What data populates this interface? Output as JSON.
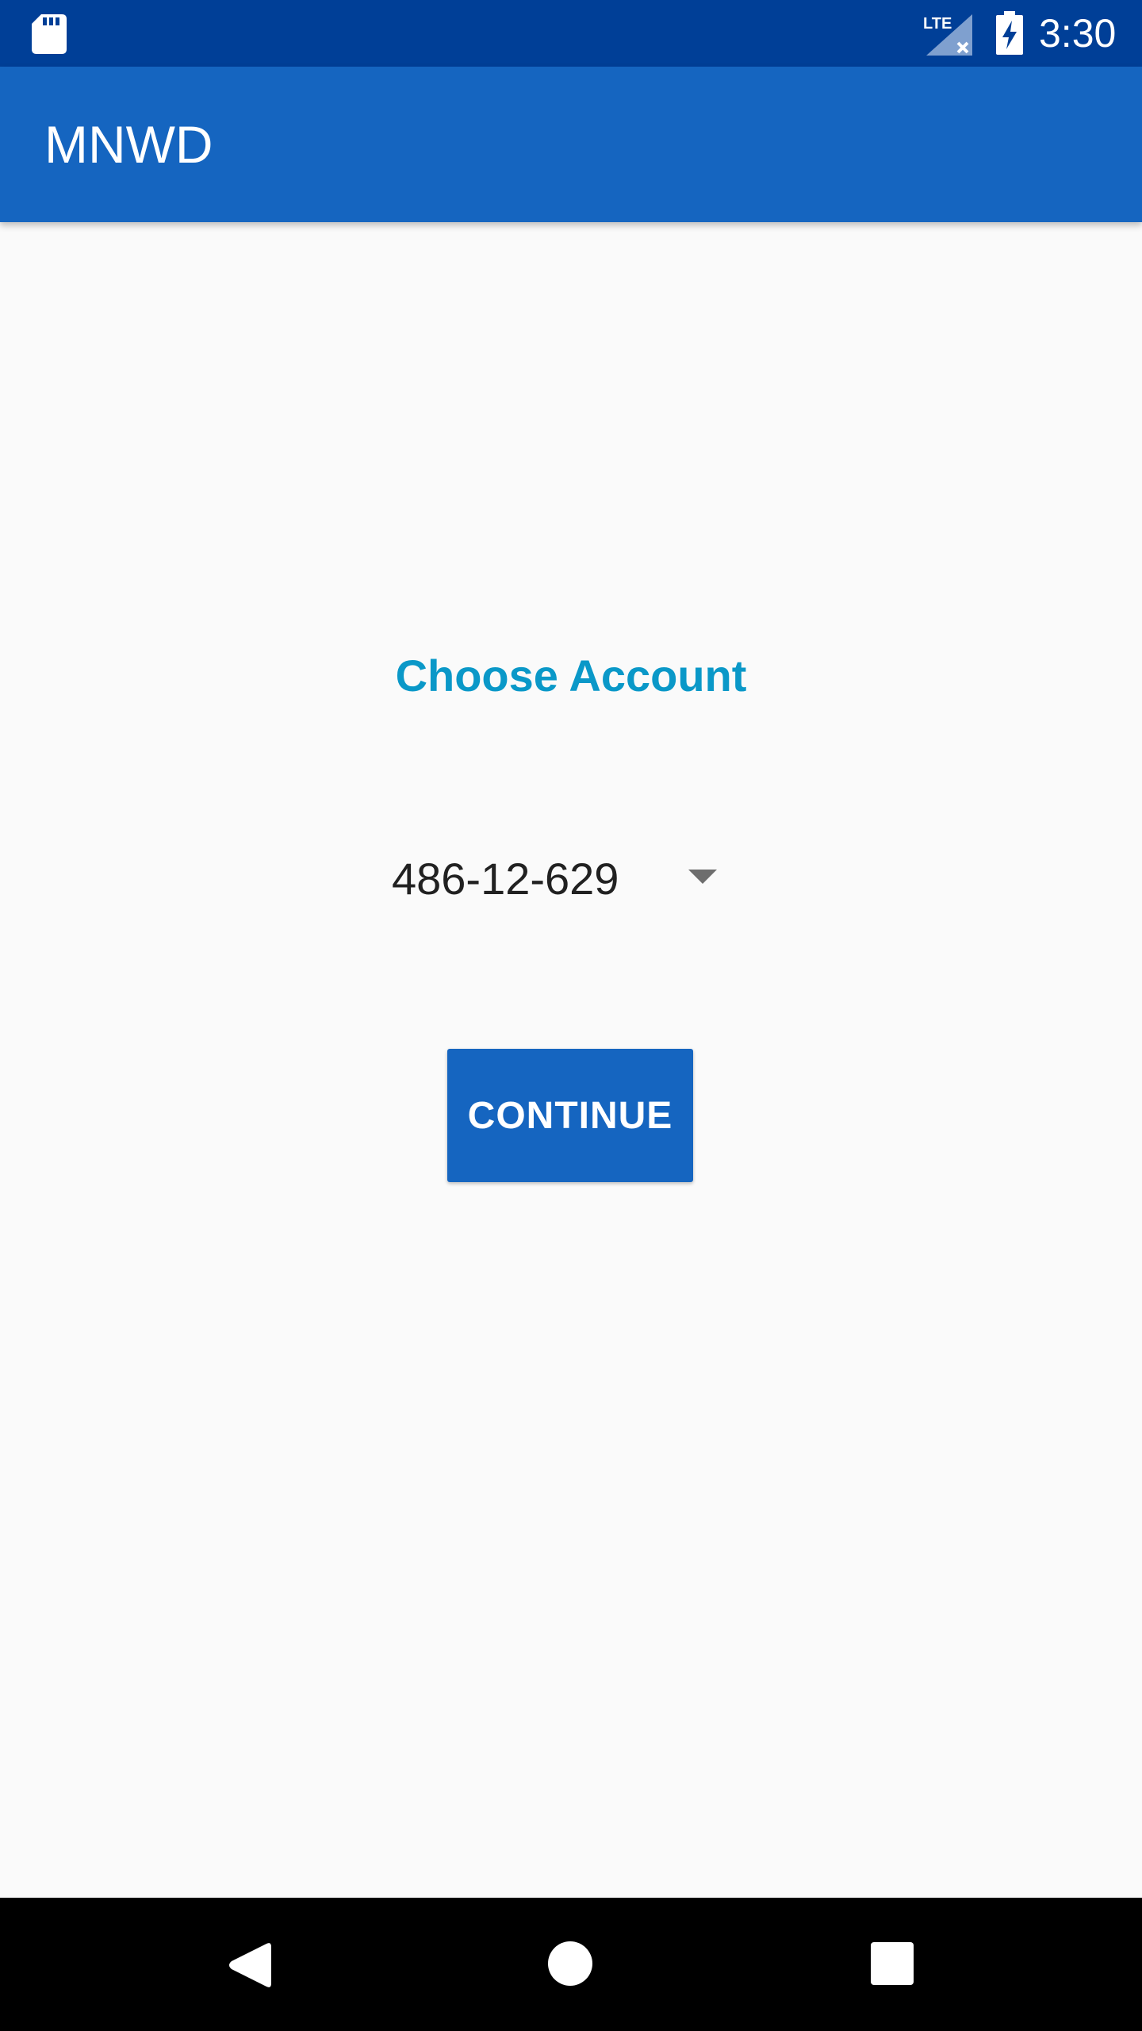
{
  "status_bar": {
    "time": "3:30",
    "network_label": "LTE",
    "icons": [
      "sd-card-icon",
      "signal-lte-icon",
      "battery-charging-icon"
    ]
  },
  "app_bar": {
    "title": "MNWD"
  },
  "main": {
    "heading": "Choose Account",
    "account_spinner": {
      "selected_value": "486-12-629"
    },
    "continue_label": "CONTINUE"
  },
  "nav_bar": {
    "icons": [
      "back-icon",
      "home-icon",
      "recents-icon"
    ]
  },
  "colors": {
    "status_bar": "#003f97",
    "app_bar": "#1565c0",
    "heading": "#0a98c8",
    "button": "#1565c0",
    "background": "#fafafa"
  }
}
